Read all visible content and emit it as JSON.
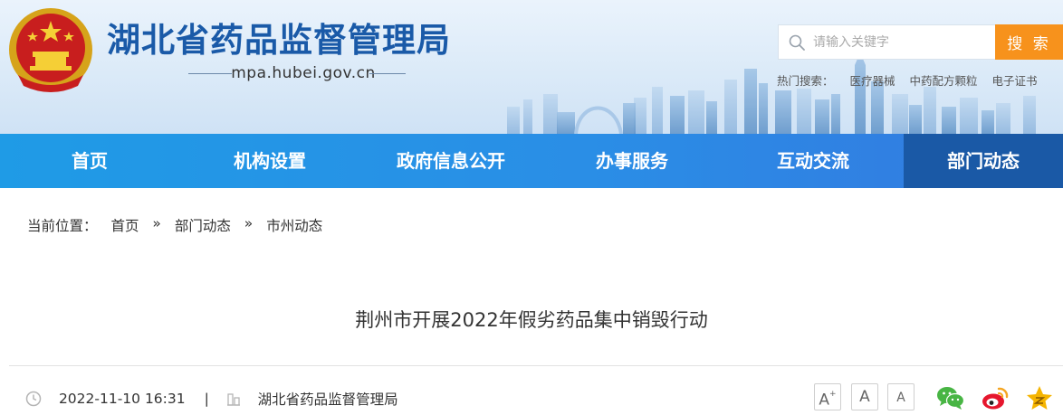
{
  "header": {
    "site_title": "湖北省药品监督管理局",
    "site_domain": "mpa.hubei.gov.cn",
    "emblem_icon": "national-emblem-icon",
    "search": {
      "placeholder": "请输入关键字",
      "button_label": "搜 索"
    },
    "hot_search": {
      "label": "热门搜索：",
      "items": [
        "医疗器械",
        "中药配方颗粒",
        "电子证书"
      ]
    }
  },
  "nav": {
    "items": [
      {
        "label": "首页",
        "active": false
      },
      {
        "label": "机构设置",
        "active": false
      },
      {
        "label": "政府信息公开",
        "active": false
      },
      {
        "label": "办事服务",
        "active": false
      },
      {
        "label": "互动交流",
        "active": false
      },
      {
        "label": "部门动态",
        "active": true
      }
    ]
  },
  "breadcrumb": {
    "label": "当前位置：",
    "separator": "»",
    "items": [
      "首页",
      "部门动态",
      "市州动态"
    ]
  },
  "article": {
    "title": "荆州市开展2022年假劣药品集中销毁行动",
    "datetime": "2022-11-10 16:31",
    "meta_separator": "|",
    "source": "湖北省药品监督管理局",
    "font_controls": {
      "increase": "A",
      "increase_sup": "+",
      "normal": "A",
      "decrease": "A"
    },
    "share_icons": [
      "wechat-icon",
      "weibo-icon",
      "favorite-star-icon"
    ]
  },
  "colors": {
    "title_blue": "#1a5aa8",
    "nav_blue": "#2a8ee6",
    "nav_active": "#1a59a6",
    "search_orange": "#f7921c",
    "wechat_green": "#48b544",
    "weibo_red": "#e6162d",
    "star_yellow": "#f5b400"
  }
}
